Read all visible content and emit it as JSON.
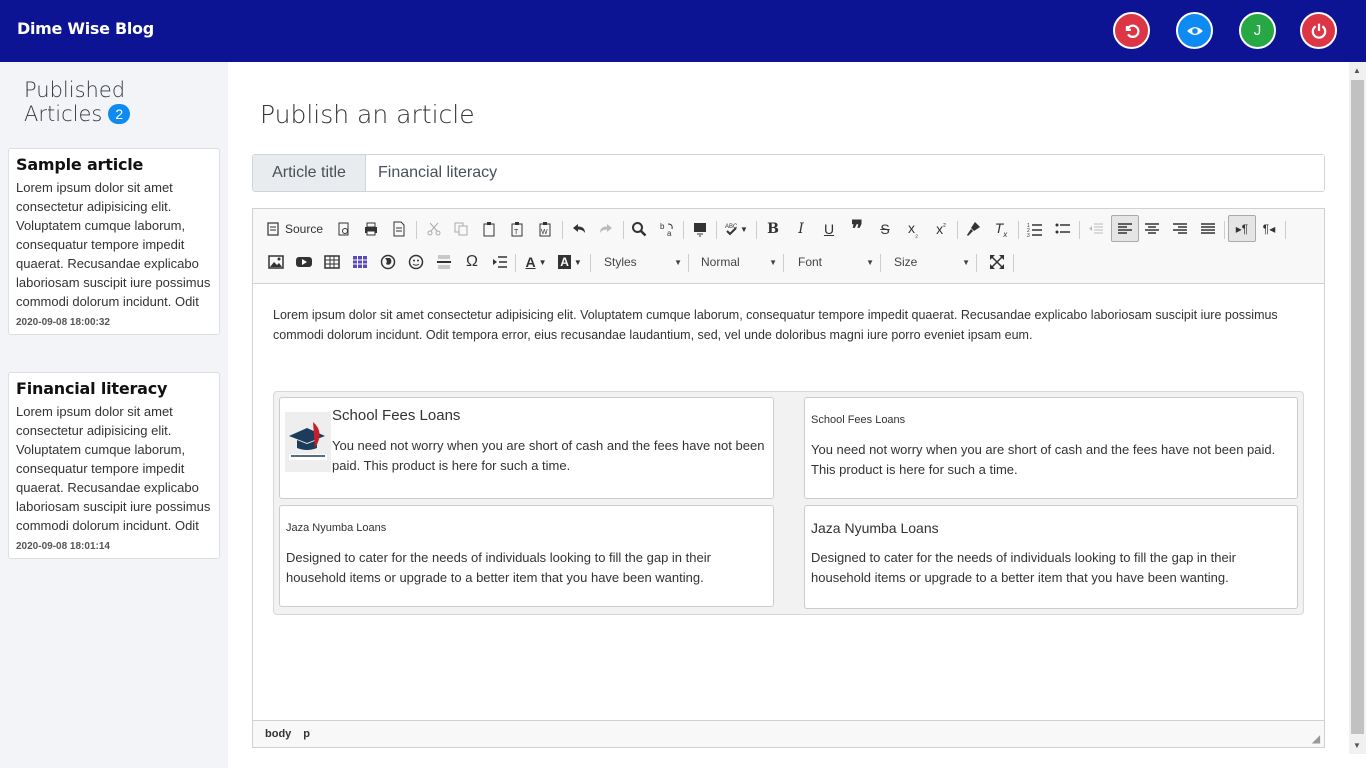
{
  "app": {
    "brand": "Dime Wise Blog",
    "user_initial": "J"
  },
  "nav_icons": [
    "undo-icon",
    "eye-icon",
    "user-avatar",
    "power-icon"
  ],
  "sidebar": {
    "title_line1": "Published",
    "title_line2": "Articles",
    "count": "2",
    "articles": [
      {
        "title": "Sample article",
        "excerpt": "Lorem ipsum dolor sit amet consectetur adipisicing elit. Voluptatem cumque laborum, consequatur tempore impedit quaerat. Recusandae explicabo laboriosam suscipit iure possimus commodi dolorum incidunt. Odit",
        "date": "2020-09-08 18:00:32"
      },
      {
        "title": "Financial literacy",
        "excerpt": "Lorem ipsum dolor sit amet consectetur adipisicing elit. Voluptatem cumque laborum, consequatur tempore impedit quaerat. Recusandae explicabo laboriosam suscipit iure possimus commodi dolorum incidunt. Odit",
        "date": "2020-09-08 18:01:14"
      }
    ]
  },
  "main": {
    "heading": "Publish an article",
    "title_label": "Article title",
    "title_value": "Financial literacy"
  },
  "editor": {
    "toolbar": {
      "source_label": "Source",
      "styles": "Styles",
      "format": "Normal",
      "font": "Font",
      "size": "Size"
    },
    "paragraph": "Lorem ipsum dolor sit amet consectetur adipisicing elit. Voluptatem cumque laborum, consequatur tempore impedit quaerat. Recusandae explicabo laboriosam suscipit iure possimus commodi dolorum incidunt. Odit tempora error, eius recusandae laudantium, sed, vel unde doloribus magni iure porro eveniet ipsam eum.",
    "cards": [
      {
        "title": "School Fees Loans",
        "text": "You need not worry when you are short of cash and the fees have not been paid. This product is here for such a time."
      },
      {
        "title": "School Fees Loans",
        "text": "You need not worry when you are short of cash and the fees have not been paid. This product is here for such a time."
      },
      {
        "title": "Jaza Nyumba Loans",
        "text": "Designed to cater for the needs of individuals looking to fill the gap in their household items or upgrade to a better item that you have been wanting."
      },
      {
        "title": "Jaza Nyumba Loans",
        "text": "Designed to cater for the needs of individuals looking to fill the gap in their household items or upgrade to a better item that you have been wanting."
      }
    ],
    "path": [
      "body",
      "p"
    ]
  }
}
